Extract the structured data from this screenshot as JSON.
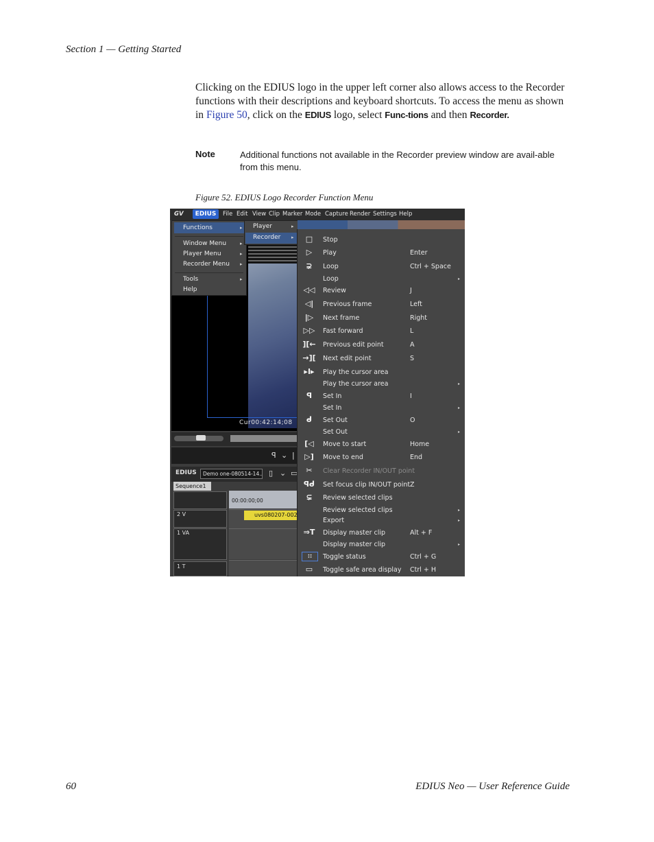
{
  "header": "Section 1 — Getting Started",
  "body": {
    "p1": "Clicking on the EDIUS logo in the upper left corner also allows access to the Recorder functions with their descriptions and keyboard shortcuts. To access the menu as shown in ",
    "link": "Figure 50",
    "p2": ", click on the ",
    "b1": "EDIUS",
    "p3": " logo, select ",
    "b2": "Func-tions",
    "p4": " and then ",
    "b3": "Recorder."
  },
  "note": {
    "label": "Note",
    "text": "Additional functions not available in the Recorder preview window are avail-able from this menu."
  },
  "caption": "Figure 52.  EDIUS Logo Recorder Function Menu",
  "screenshot": {
    "logo": "EDIUS",
    "gv_logo": "GV",
    "menubar": [
      "File",
      "Edit",
      "View",
      "Clip",
      "Marker",
      "Mode",
      "Capture",
      "Render",
      "Settings",
      "Help"
    ],
    "menu1": [
      {
        "label": "Functions",
        "arrow": "▸"
      },
      {
        "label": "Window Menu",
        "arrow": "▸"
      },
      {
        "label": "Player Menu",
        "arrow": "▸"
      },
      {
        "label": "Recorder Menu",
        "arrow": "▸"
      },
      {
        "label": "Tools",
        "arrow": "▸"
      },
      {
        "label": "Help",
        "arrow": ""
      }
    ],
    "menu2": [
      {
        "label": "Player",
        "arrow": "▸"
      },
      {
        "label": "Recorder",
        "arrow": "▸"
      }
    ],
    "recorder_menu": [
      {
        "icon": "□",
        "label": "Stop",
        "key": "",
        "sub": false,
        "dim": false
      },
      {
        "icon": "▷",
        "label": "Play",
        "key": "Enter",
        "sub": false,
        "dim": false
      },
      {
        "icon": "⊋",
        "label": "Loop",
        "key": "Ctrl + Space",
        "sub": false,
        "dim": false
      },
      {
        "icon": "",
        "label": "Loop",
        "key": "",
        "sub": true,
        "dim": false
      },
      {
        "icon": "◁◁",
        "label": "Review",
        "key": "J",
        "sub": false,
        "dim": false
      },
      {
        "icon": "◁|",
        "label": "Previous frame",
        "key": "Left",
        "sub": false,
        "dim": false
      },
      {
        "icon": "|▷",
        "label": "Next frame",
        "key": "Right",
        "sub": false,
        "dim": false
      },
      {
        "icon": "▷▷",
        "label": "Fast forward",
        "key": "L",
        "sub": false,
        "dim": false
      },
      {
        "icon": "][←",
        "label": "Previous edit point",
        "key": "A",
        "sub": false,
        "dim": false
      },
      {
        "icon": "→][",
        "label": "Next edit point",
        "key": "S",
        "sub": false,
        "dim": false
      },
      {
        "icon": "▸I▸",
        "label": "Play the cursor area",
        "key": "",
        "sub": false,
        "dim": false
      },
      {
        "icon": "",
        "label": "Play the cursor area",
        "key": "",
        "sub": true,
        "dim": false
      },
      {
        "icon": "ꟼ",
        "label": "Set In",
        "key": "I",
        "sub": false,
        "dim": false
      },
      {
        "icon": "",
        "label": "Set In",
        "key": "",
        "sub": true,
        "dim": false
      },
      {
        "icon": "ᑯ",
        "label": "Set Out",
        "key": "O",
        "sub": false,
        "dim": false
      },
      {
        "icon": "",
        "label": "Set Out",
        "key": "",
        "sub": true,
        "dim": false
      },
      {
        "icon": "[◁",
        "label": "Move to start",
        "key": "Home",
        "sub": false,
        "dim": false
      },
      {
        "icon": "▷]",
        "label": "Move to end",
        "key": "End",
        "sub": false,
        "dim": false
      },
      {
        "icon": "✂",
        "label": "Clear Recorder IN/OUT point",
        "key": "",
        "sub": false,
        "dim": true
      },
      {
        "icon": "ꟼᑯ",
        "label": "Set focus clip IN/OUT point",
        "key": "Z",
        "sub": false,
        "dim": false
      },
      {
        "icon": "⊊",
        "label": "Review selected clips",
        "key": "",
        "sub": false,
        "dim": false
      },
      {
        "icon": "",
        "label": "Review selected clips",
        "key": "",
        "sub": true,
        "dim": false
      },
      {
        "icon": "",
        "label": "Export",
        "key": "",
        "sub": true,
        "dim": false
      },
      {
        "icon": "⇒T",
        "label": "Display master clip",
        "key": "Alt + F",
        "sub": false,
        "dim": false
      },
      {
        "icon": "",
        "label": "Display master clip",
        "key": "",
        "sub": true,
        "dim": false
      },
      {
        "icon": "∷",
        "label": "Toggle status",
        "key": "Ctrl + G",
        "sub": false,
        "dim": false
      },
      {
        "icon": "▭",
        "label": "Toggle safe area display",
        "key": "Ctrl + H",
        "sub": false,
        "dim": false
      }
    ],
    "timecode": "Cur00:42:14;08",
    "timeline": {
      "project": "Demo one-080514-14...",
      "sequence": "Sequence1",
      "ruler_tc": "00:00:00;00",
      "clip": "uvs080207-002",
      "tracks": [
        "2 V",
        "1 VA",
        "1 T"
      ]
    }
  },
  "footer": {
    "page": "60",
    "title": "EDIUS Neo  —  User Reference Guide"
  }
}
